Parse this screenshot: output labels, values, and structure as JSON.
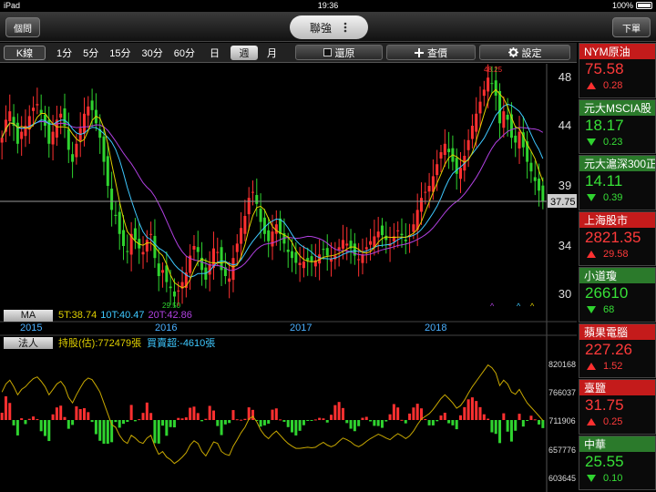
{
  "status": {
    "carrier": "iPad",
    "time": "19:36",
    "battery": "100%"
  },
  "header": {
    "left_button": "個問",
    "right_button": "下單",
    "stock_name": "聯強",
    "menu_icon": "dots-icon"
  },
  "toolbar": {
    "kline_label": "K線",
    "periods": [
      "1分",
      "5分",
      "15分",
      "30分",
      "60分",
      "日",
      "週",
      "月"
    ],
    "selected_period": "週",
    "restore_label": "還原",
    "query_label": "查價",
    "settings_label": "設定"
  },
  "price_axis": {
    "ticks": [
      "48",
      "44",
      "39",
      "34",
      "30"
    ],
    "last_price": "37.75"
  },
  "annotations": {
    "high": "48.25",
    "low": "29.50"
  },
  "ma_legend": {
    "tag": "MA",
    "ma5": "5T:38.74",
    "ma10": "10T:40.47",
    "ma20": "20T:42.86"
  },
  "years": [
    "2015",
    "2016",
    "2017",
    "2018"
  ],
  "institutional": {
    "tag": "法人",
    "holding": "持股(估):772479張",
    "net": "買賣超:-4610張"
  },
  "volume_axis": {
    "ticks": [
      "820168",
      "766037",
      "711906",
      "657776",
      "603645"
    ]
  },
  "colors": {
    "up": "#ff3030",
    "down": "#2fd32f",
    "ma5": "#e0d000",
    "ma10": "#3ec8ff",
    "ma20": "#b040e0"
  },
  "chart_data": {
    "type": "candlestick",
    "x_range": [
      "2015",
      "2018"
    ],
    "price_range": [
      30,
      48
    ],
    "weekly_close": [
      43,
      44.5,
      45.2,
      44,
      42.5,
      43.5,
      44,
      44.8,
      45.5,
      45.8,
      45,
      44,
      42.5,
      43.5,
      44.5,
      45,
      44,
      42,
      41,
      42.5,
      43.8,
      45,
      45.6,
      45.3,
      44.2,
      43,
      41,
      39,
      37,
      36.5,
      35,
      34,
      33.5,
      35,
      34.5,
      33.8,
      33.5,
      34.5,
      35,
      33,
      31.5,
      32,
      31,
      30.5,
      29.8,
      30.3,
      31,
      31.8,
      33.2,
      34,
      33.5,
      32,
      31.2,
      32.5,
      33.8,
      33.5,
      32,
      31.5,
      31.3,
      33,
      34.2,
      35.5,
      36.5,
      38,
      38.5,
      37.5,
      36,
      35,
      34.4,
      35.2,
      35.8,
      35,
      34.2,
      33.5,
      33,
      32.6,
      32.6,
      32.7,
      32.8,
      32.7,
      32.8,
      33.3,
      33.7,
      33.2,
      32.9,
      33.2,
      33.9,
      34.5,
      34.2,
      33.8,
      33.2,
      32.9,
      33.3,
      33.9,
      34.4,
      34.8,
      35.2,
      34.9,
      34.5,
      34.2,
      34.8,
      35.3,
      34.9,
      34.4,
      34.9,
      35.8,
      37,
      38,
      38.5,
      39,
      39.8,
      40.8,
      41.8,
      42.5,
      41.8,
      41,
      40,
      40.5,
      41.5,
      42.8,
      44,
      45,
      46,
      47,
      48,
      47.5,
      46.5,
      44.2,
      45.2,
      44.5,
      43,
      42.6,
      43.5,
      42.2,
      41,
      40.2,
      39.4,
      38.6,
      37.75
    ],
    "ma5": "38.74",
    "ma10": "40.47",
    "ma20": "42.86",
    "holding_range": [
      603645,
      820168
    ]
  },
  "sidebar": [
    {
      "name": "NYM原油",
      "price": "75.58",
      "change": "0.28",
      "dir": "up"
    },
    {
      "name": "元大MSCIA股",
      "price": "18.17",
      "change": "0.23",
      "dir": "down"
    },
    {
      "name": "元大滬深300正2",
      "price": "14.11",
      "change": "0.39",
      "dir": "down"
    },
    {
      "name": "上海股市",
      "price": "2821.35",
      "change": "29.58",
      "dir": "up"
    },
    {
      "name": "小道瓊",
      "price": "26610",
      "change": "68",
      "dir": "down"
    },
    {
      "name": "蘋果電腦",
      "price": "227.26",
      "change": "1.52",
      "dir": "up"
    },
    {
      "name": "臺鹽",
      "price": "31.75",
      "change": "0.25",
      "dir": "up"
    },
    {
      "name": "中華",
      "price": "25.55",
      "change": "0.10",
      "dir": "down"
    }
  ]
}
